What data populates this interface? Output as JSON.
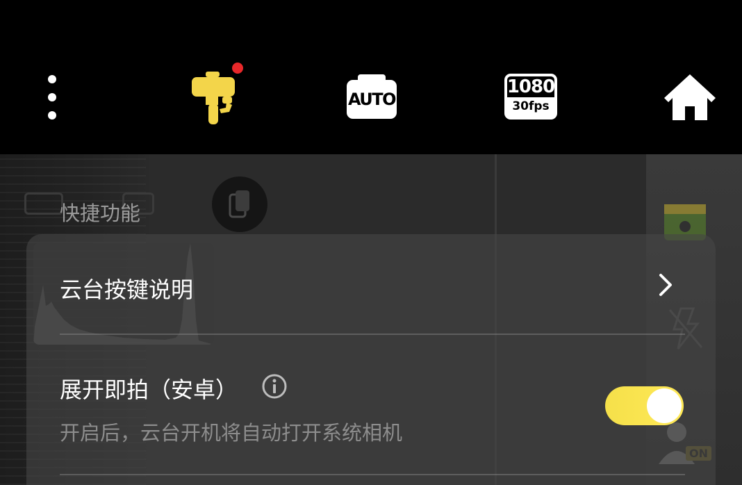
{
  "topbar": {
    "more_icon": "more-vertical-icon",
    "gimbal_icon": "gimbal-icon",
    "gimbal_color": "#f3d54a",
    "notification_color": "#e8282a",
    "camera_mode_label": "AUTO",
    "resolution_label": "1080",
    "framerate_label": "30fps",
    "home_icon": "home-icon"
  },
  "section": {
    "title": "快捷功能"
  },
  "items": {
    "gimbal_buttons": {
      "label": "云台按键说明",
      "chevron_icon": "chevron-right-icon"
    },
    "expand_shoot": {
      "label": "展开即拍（安卓）",
      "info_icon": "info-icon",
      "description": "开启后，云台开机将自动打开系统相机",
      "toggle_on": true,
      "toggle_color": "#f5e04a"
    }
  },
  "background": {
    "on_badge": "ON"
  }
}
